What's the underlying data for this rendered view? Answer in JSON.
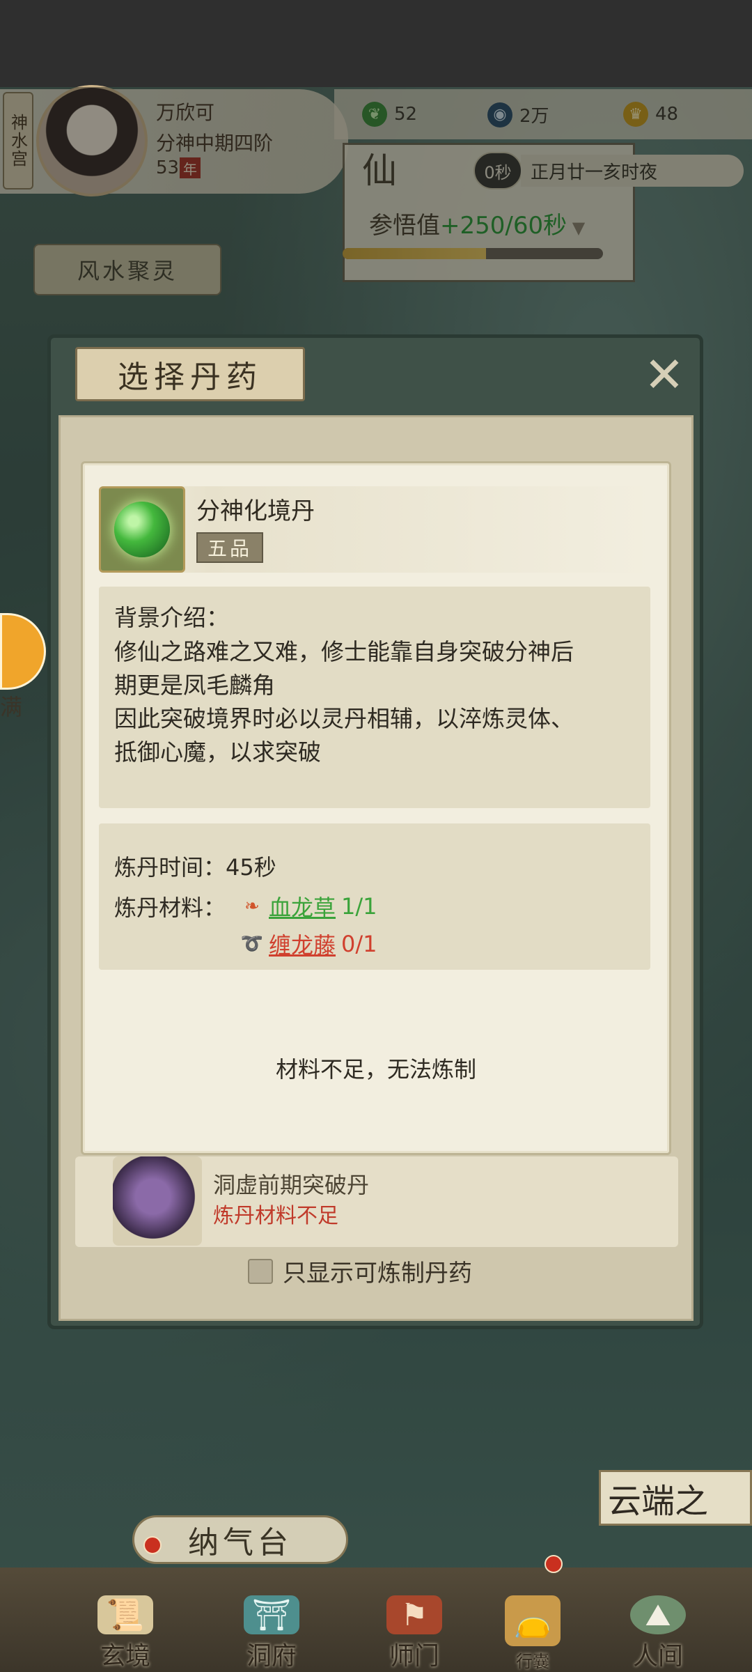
{
  "header": {
    "sect": "神水宫",
    "player_name": "万欣可",
    "realm": "分神中期四阶",
    "age": "53",
    "age_unit": "年",
    "resources": [
      {
        "icon": "jade-leaf-icon",
        "value": "52"
      },
      {
        "icon": "coin-icon",
        "value": "2万"
      },
      {
        "icon": "gold-ingot-icon",
        "value": "48"
      }
    ],
    "panel_title": "仙",
    "timer": "0秒",
    "date": "正月廿一亥时夜",
    "insight_label": "参悟值",
    "insight_rate": "+250/60秒",
    "insight_progress": 0.55,
    "fengshui": "风水聚灵"
  },
  "modal": {
    "title": "选择丹药",
    "list_item": {
      "name": "洞虚前期突破丹",
      "status": "炼丹材料不足"
    },
    "only_show_label": "只显示可炼制丹药"
  },
  "detail": {
    "pill_name": "分神化境丹",
    "grade": "五品",
    "background_label": "背景介绍：",
    "background_lines": [
      "修仙之路难之又难，修士能靠自身突破分神后",
      "期更是凤毛麟角",
      "因此突破境界时必以灵丹相辅，以淬炼灵体、",
      "抵御心魔，以求突破"
    ],
    "time_label": "炼丹时间：",
    "time_value": "45秒",
    "materials_label": "炼丹材料：",
    "materials": [
      {
        "name": "血龙草",
        "count": "1/1",
        "status_color": "#3aa33a"
      },
      {
        "name": "缠龙藤",
        "count": "0/1",
        "status_color": "#d0402e"
      }
    ],
    "warning": "材料不足，无法炼制"
  },
  "side": {
    "label": "满"
  },
  "bottom": {
    "platform": "纳气台",
    "cloud": "云端之",
    "nav": [
      "玄境",
      "洞府",
      "师门",
      "行囊",
      "人间"
    ]
  }
}
